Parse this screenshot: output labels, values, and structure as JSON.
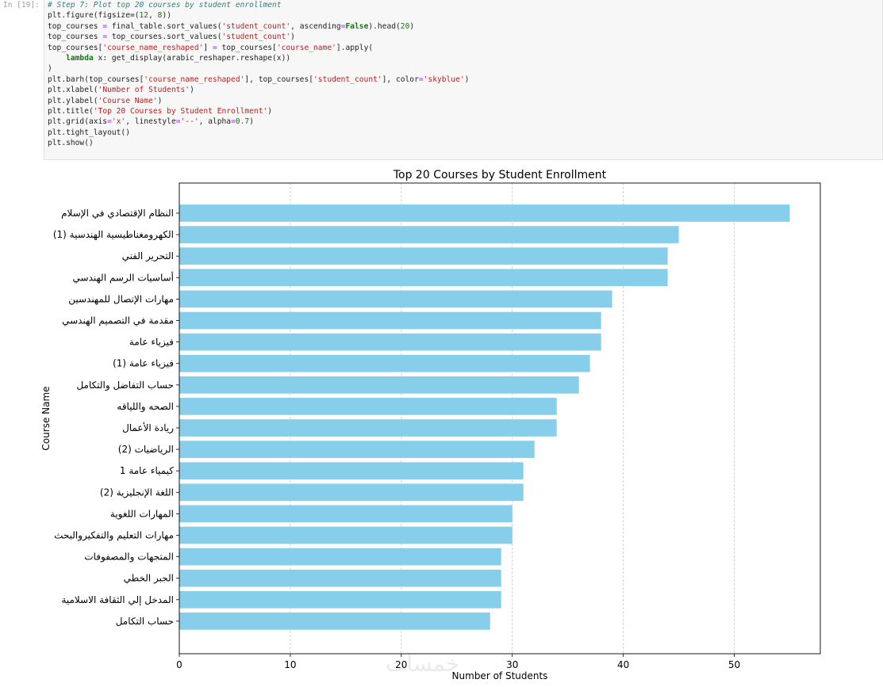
{
  "notebook": {
    "prompt": "In [19]:",
    "code_lines": [
      [
        {
          "t": "c",
          "v": "# Step 7: Plot top 20 courses by student enrollment"
        }
      ],
      [
        {
          "t": "p",
          "v": "plt.figure(figsize=("
        },
        {
          "t": "n",
          "v": "12"
        },
        {
          "t": "p",
          "v": ", "
        },
        {
          "t": "n",
          "v": "8"
        },
        {
          "t": "p",
          "v": "))"
        }
      ],
      [
        {
          "t": "p",
          "v": "top_courses "
        },
        {
          "t": "o",
          "v": "="
        },
        {
          "t": "p",
          "v": " final_table.sort_values("
        },
        {
          "t": "s",
          "v": "'student_count'"
        },
        {
          "t": "p",
          "v": ", ascending"
        },
        {
          "t": "o",
          "v": "="
        },
        {
          "t": "k",
          "v": "False"
        },
        {
          "t": "p",
          "v": ").head("
        },
        {
          "t": "n",
          "v": "20"
        },
        {
          "t": "p",
          "v": ")"
        }
      ],
      [
        {
          "t": "p",
          "v": "top_courses "
        },
        {
          "t": "o",
          "v": "="
        },
        {
          "t": "p",
          "v": " top_courses.sort_values("
        },
        {
          "t": "s",
          "v": "'student_count'"
        },
        {
          "t": "p",
          "v": ")"
        }
      ],
      [
        {
          "t": "p",
          "v": "top_courses["
        },
        {
          "t": "s",
          "v": "'course_name_reshaped'"
        },
        {
          "t": "p",
          "v": "] "
        },
        {
          "t": "o",
          "v": "="
        },
        {
          "t": "p",
          "v": " top_courses["
        },
        {
          "t": "s",
          "v": "'course_name'"
        },
        {
          "t": "p",
          "v": "].apply("
        }
      ],
      [
        {
          "t": "p",
          "v": "    "
        },
        {
          "t": "k",
          "v": "lambda"
        },
        {
          "t": "p",
          "v": " x: get_display(arabic_reshaper.reshape(x))"
        }
      ],
      [
        {
          "t": "p",
          "v": ")"
        }
      ],
      [
        {
          "t": "p",
          "v": "plt.barh(top_courses["
        },
        {
          "t": "s",
          "v": "'course_name_reshaped'"
        },
        {
          "t": "p",
          "v": "], top_courses["
        },
        {
          "t": "s",
          "v": "'student_count'"
        },
        {
          "t": "p",
          "v": "], color"
        },
        {
          "t": "o",
          "v": "="
        },
        {
          "t": "s",
          "v": "'skyblue'"
        },
        {
          "t": "p",
          "v": ")"
        }
      ],
      [
        {
          "t": "p",
          "v": "plt.xlabel("
        },
        {
          "t": "s",
          "v": "'Number of Students'"
        },
        {
          "t": "p",
          "v": ")"
        }
      ],
      [
        {
          "t": "p",
          "v": "plt.ylabel("
        },
        {
          "t": "s",
          "v": "'Course Name'"
        },
        {
          "t": "p",
          "v": ")"
        }
      ],
      [
        {
          "t": "p",
          "v": "plt.title("
        },
        {
          "t": "s",
          "v": "'Top 20 Courses by Student Enrollment'"
        },
        {
          "t": "p",
          "v": ")"
        }
      ],
      [
        {
          "t": "p",
          "v": "plt.grid(axis"
        },
        {
          "t": "o",
          "v": "="
        },
        {
          "t": "s",
          "v": "'x'"
        },
        {
          "t": "p",
          "v": ", linestyle"
        },
        {
          "t": "o",
          "v": "="
        },
        {
          "t": "s",
          "v": "'--'"
        },
        {
          "t": "p",
          "v": ", alpha"
        },
        {
          "t": "o",
          "v": "="
        },
        {
          "t": "n",
          "v": "0.7"
        },
        {
          "t": "p",
          "v": ")"
        }
      ],
      [
        {
          "t": "p",
          "v": "plt.tight_layout()"
        }
      ],
      [
        {
          "t": "p",
          "v": "plt.show()"
        }
      ]
    ]
  },
  "watermark": "خمسات",
  "chart_data": {
    "type": "bar",
    "orientation": "horizontal",
    "title": "Top 20 Courses by Student Enrollment",
    "xlabel": "Number of Students",
    "ylabel": "Course Name",
    "xlim": [
      0,
      57.75
    ],
    "xticks": [
      0,
      10,
      20,
      30,
      40,
      50
    ],
    "grid": {
      "axis": "x",
      "linestyle": "dashed"
    },
    "bar_color": "#87ceeb",
    "categories": [
      "النظام الإقتصادي في الإسلام",
      "الكهرومغناطيسية الهندسية (1)",
      "التحرير الفني",
      "أساسيات الرسم الهندسي",
      "مهارات الإتصال للمهندسين",
      "مقدمة في التصميم الهندسي",
      "فيزياء عامة",
      "فيزياء عامة (1)",
      "حساب التفاضل والتكامل",
      "الصحه واللياقه",
      "ريادة الأعمال",
      "الرياضيات (2)",
      "كيمياء عامة 1",
      "اللغة الإنجليزية (2)",
      "المهارات اللغوية",
      "مهارات التعليم والتفكيروالبحث",
      "المتجهات والمصفوفات",
      "الجبر الخطي",
      "المدخل إلي الثقافة الاسلامية",
      "حساب التكامل"
    ],
    "values": [
      55,
      45,
      44,
      44,
      39,
      38,
      38,
      37,
      36,
      34,
      34,
      32,
      31,
      31,
      30,
      30,
      29,
      29,
      29,
      28
    ]
  }
}
